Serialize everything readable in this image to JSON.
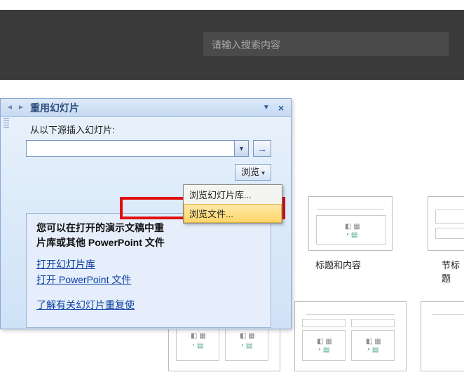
{
  "top": {
    "search_placeholder": "请输入搜索内容"
  },
  "taskpane": {
    "title": "重用幻灯片",
    "insert_label": "从以下源插入幻灯片:",
    "input_value": "",
    "browse_label": "浏览",
    "dropdown": {
      "item_library": "浏览幻灯片库...",
      "item_file": "浏览文件..."
    },
    "info_text_1": "您可以在打开的演示文稿中重",
    "info_text_2": "片库或其他 PowerPoint 文件",
    "link_open_library": "打开幻灯片库",
    "link_open_file": "打开 PowerPoint 文件",
    "link_learn": "了解有关幻灯片重复使"
  },
  "gallery": {
    "label_title_content": "标题和内容",
    "label_section": "节标题"
  }
}
